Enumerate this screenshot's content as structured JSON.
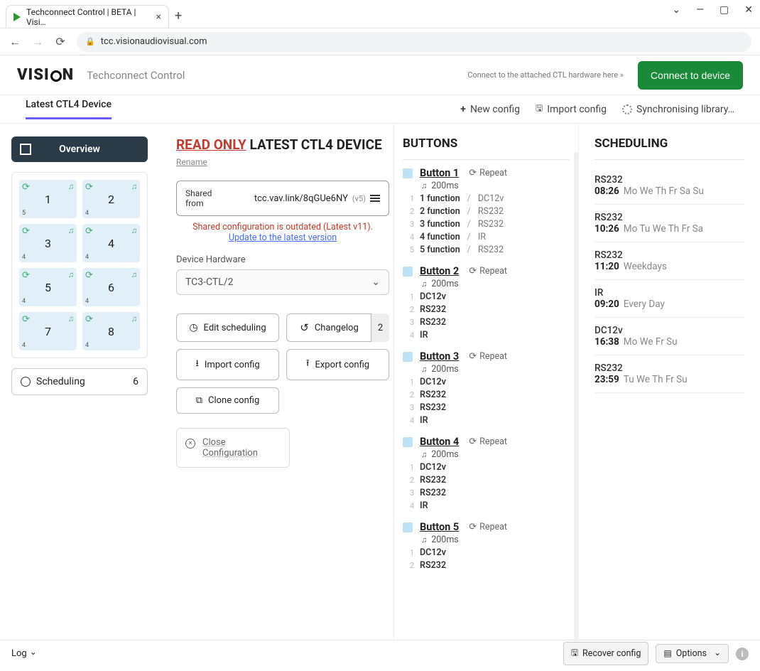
{
  "browser": {
    "tab_title": "Techconnect Control | BETA | Visi…",
    "url": "tcc.visionaudiovisual.com"
  },
  "header": {
    "brand_pre": "VISI",
    "brand_post": "N",
    "app_title": "Techconnect Control",
    "hint": "Connect to the attached CTL hardware here »",
    "connect_btn": "Connect to device"
  },
  "toolbar": {
    "active_tab": "Latest CTL4 Device",
    "new_config": "New config",
    "import_config": "Import config",
    "sync": "Synchronising library…"
  },
  "sidebar": {
    "overview": "Overview",
    "cells": [
      {
        "n": "1",
        "bl": "5"
      },
      {
        "n": "2",
        "bl": "4"
      },
      {
        "n": "3",
        "bl": "4"
      },
      {
        "n": "4",
        "bl": "4"
      },
      {
        "n": "5",
        "bl": "4"
      },
      {
        "n": "6",
        "bl": "4"
      },
      {
        "n": "7",
        "bl": "4"
      },
      {
        "n": "8",
        "bl": "4"
      }
    ],
    "scheduling_label": "Scheduling",
    "scheduling_count": "6"
  },
  "config": {
    "read_only": "READ ONLY",
    "title_rest": " LATEST CTL4 DEVICE",
    "rename": "Rename",
    "shared_from": "Shared from",
    "share_url": "tcc.vav.link/8qGUe6NY",
    "share_ver": "(v5)",
    "outdated": "Shared configuration is outdated (Latest v11).",
    "update_link": "Update to the latest version",
    "hardware_label": "Device Hardware",
    "hardware_value": "TC3-CTL/2",
    "actions": {
      "edit_sched": "Edit scheduling",
      "changelog": "Changelog",
      "changelog_count": "2",
      "import": "Import config",
      "export": "Export config",
      "clone": "Clone config"
    },
    "close1": "Close",
    "close2": "Configuration"
  },
  "buttons_section": {
    "title": "BUTTONS",
    "repeat_label": "Repeat",
    "delay_ms": "200ms",
    "blocks": [
      {
        "name": "Button 1",
        "fns": [
          {
            "label": "1 function",
            "type": "DC12v"
          },
          {
            "label": "2 function",
            "type": "RS232"
          },
          {
            "label": "3 function",
            "type": "RS232"
          },
          {
            "label": "4 function",
            "type": "IR"
          },
          {
            "label": "5 function",
            "type": "RS232"
          }
        ]
      },
      {
        "name": "Button 2",
        "fns": [
          {
            "label": "DC12v",
            "type": ""
          },
          {
            "label": "RS232",
            "type": ""
          },
          {
            "label": "RS232",
            "type": ""
          },
          {
            "label": "IR",
            "type": ""
          }
        ]
      },
      {
        "name": "Button 3",
        "fns": [
          {
            "label": "DC12v",
            "type": ""
          },
          {
            "label": "RS232",
            "type": ""
          },
          {
            "label": "RS232",
            "type": ""
          },
          {
            "label": "IR",
            "type": ""
          }
        ]
      },
      {
        "name": "Button 4",
        "fns": [
          {
            "label": "DC12v",
            "type": ""
          },
          {
            "label": "RS232",
            "type": ""
          },
          {
            "label": "RS232",
            "type": ""
          },
          {
            "label": "IR",
            "type": ""
          }
        ]
      },
      {
        "name": "Button 5",
        "fns": [
          {
            "label": "DC12v",
            "type": ""
          },
          {
            "label": "RS232",
            "type": ""
          }
        ]
      }
    ]
  },
  "scheduling": {
    "title": "SCHEDULING",
    "items": [
      {
        "type": "RS232",
        "time": "08:26",
        "days": "Mo We Th Fr Sa Su"
      },
      {
        "type": "RS232",
        "time": "10:26",
        "days": "Mo Tu We Th Fr Sa"
      },
      {
        "type": "RS232",
        "time": "11:20",
        "days": "Weekdays"
      },
      {
        "type": "IR",
        "time": "09:20",
        "days": "Every Day"
      },
      {
        "type": "DC12v",
        "time": "16:38",
        "days": "Mo We Fr Su"
      },
      {
        "type": "RS232",
        "time": "23:59",
        "days": "Tu We Th Fr Su"
      }
    ]
  },
  "footer": {
    "log": "Log",
    "recover": "Recover config",
    "options": "Options"
  }
}
